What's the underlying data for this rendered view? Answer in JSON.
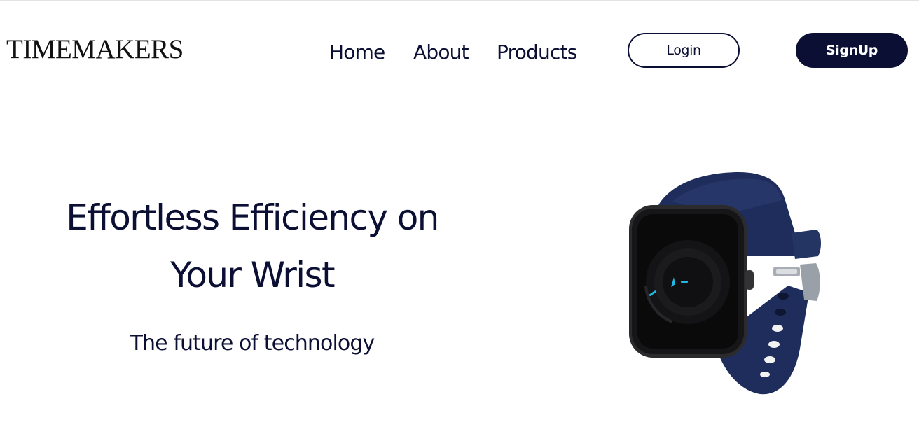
{
  "header": {
    "logo": "TIMEMAKERS",
    "nav": {
      "home": "Home",
      "about": "About",
      "products": "Products"
    },
    "login_label": "Login",
    "signup_label": "SignUp"
  },
  "hero": {
    "title": "Effortless Efficiency on Your Wrist",
    "subtitle": "The future of technology",
    "image_icon": "smartwatch-image"
  },
  "colors": {
    "brand_navy": "#0b0f33",
    "strap_blue": "#1f2d5c",
    "accent_cyan": "#22b8e6",
    "background": "#ffffff"
  }
}
